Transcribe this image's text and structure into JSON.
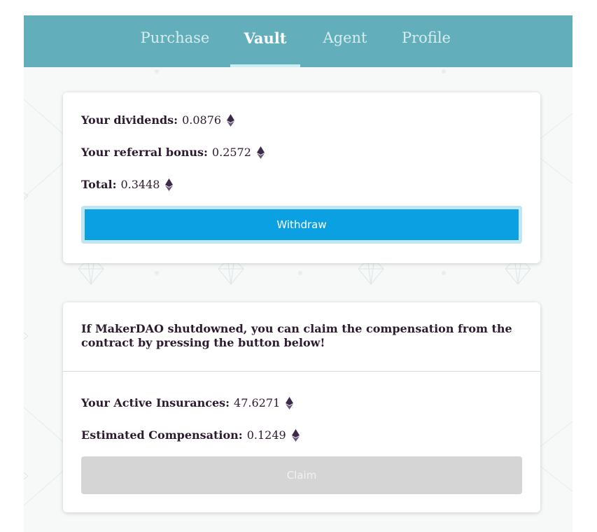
{
  "nav": {
    "tabs": [
      {
        "label": "Purchase",
        "active": false
      },
      {
        "label": "Vault",
        "active": true
      },
      {
        "label": "Agent",
        "active": false
      },
      {
        "label": "Profile",
        "active": false
      }
    ]
  },
  "vault": {
    "dividends_label": "Your dividends:",
    "dividends_value": "0.0876",
    "referral_label": "Your referral bonus:",
    "referral_value": "0.2572",
    "total_label": "Total:",
    "total_value": "0.3448",
    "withdraw_label": "Withdraw"
  },
  "insurance": {
    "notice": "If MakerDAO shutdowned, you can claim the compensation from the contract by pressing the button below!",
    "active_label": "Your Active Insurances:",
    "active_value": "47.6271",
    "compensation_label": "Estimated Compensation:",
    "compensation_value": "0.1249",
    "claim_label": "Claim",
    "claim_disabled": true
  },
  "icons": {
    "currency": "ethereum-icon",
    "background": "diamond-pattern"
  },
  "colors": {
    "navbar": "#62afbb",
    "primary_button": "#0ba0e2",
    "disabled_button": "#d5d5d5",
    "text": "#2c1a2e"
  }
}
